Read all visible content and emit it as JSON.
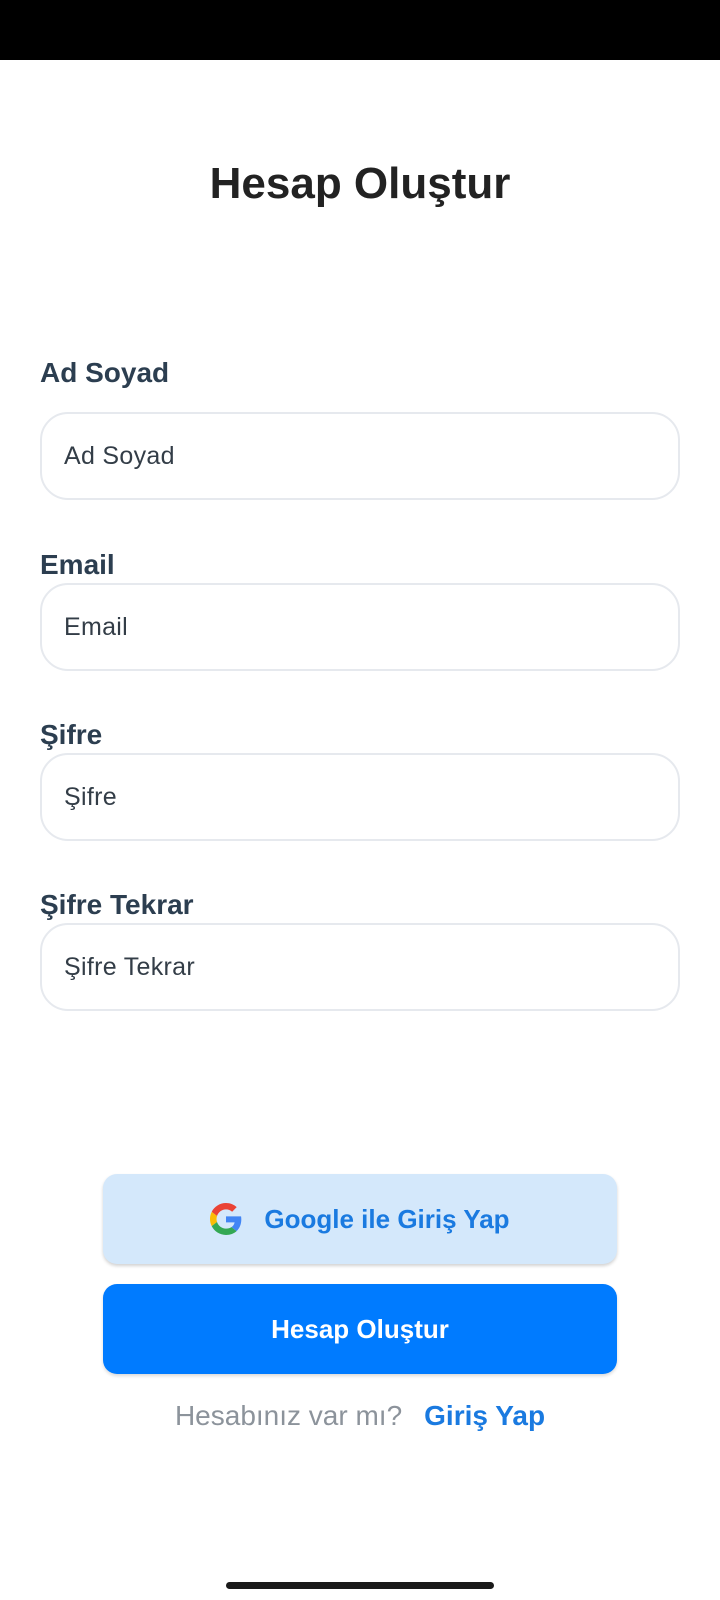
{
  "header": {
    "title": "Hesap Oluştur"
  },
  "form": {
    "fields": [
      {
        "label": "Ad Soyad",
        "placeholder": "Ad Soyad",
        "value": ""
      },
      {
        "label": "Email",
        "placeholder": "Email",
        "value": ""
      },
      {
        "label": "Şifre",
        "placeholder": "Şifre",
        "value": ""
      },
      {
        "label": "Şifre Tekrar",
        "placeholder": "Şifre Tekrar",
        "value": ""
      }
    ]
  },
  "actions": {
    "google_label": "Google ile Giriş Yap",
    "google_icon": "google-icon",
    "create_label": "Hesap Oluştur"
  },
  "footer": {
    "prompt": "Hesabınız var mı?",
    "login_link": "Giriş Yap"
  },
  "colors": {
    "primary": "#007bff",
    "google_button_bg": "#d4e8fb",
    "link": "#1a7ae0",
    "title_text": "#222222",
    "label_text": "#2c3e50",
    "muted_text": "#8c939b"
  }
}
